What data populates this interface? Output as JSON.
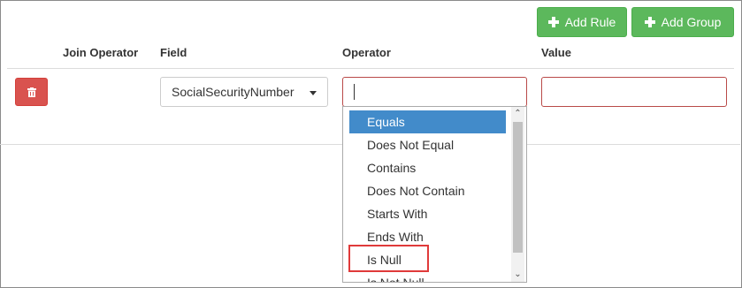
{
  "toolbar": {
    "add_rule_label": "Add Rule",
    "add_group_label": "Add Group"
  },
  "columns": {
    "join_operator": "Join Operator",
    "field": "Field",
    "operator": "Operator",
    "value": "Value"
  },
  "rule": {
    "field_value": "SocialSecurityNumber",
    "operator_value": "",
    "value_value": ""
  },
  "operator_options": [
    {
      "label": "Equals",
      "selected": true
    },
    {
      "label": "Does Not Equal",
      "selected": false
    },
    {
      "label": "Contains",
      "selected": false
    },
    {
      "label": "Does Not Contain",
      "selected": false
    },
    {
      "label": "Starts With",
      "selected": false
    },
    {
      "label": "Ends With",
      "selected": false
    },
    {
      "label": "Is Null",
      "selected": false
    },
    {
      "label": "Is Not Null",
      "selected": false
    }
  ],
  "colors": {
    "add_button": "#5cb85c",
    "delete_button": "#d9534f",
    "selected_option": "#428bca",
    "invalid_border": "#b94a48",
    "highlight_box": "#e03a3a"
  },
  "icons": {
    "add_rule": "plus-icon",
    "add_group": "plus-icon",
    "delete": "trash-icon",
    "field_dropdown": "caret-down-icon"
  }
}
